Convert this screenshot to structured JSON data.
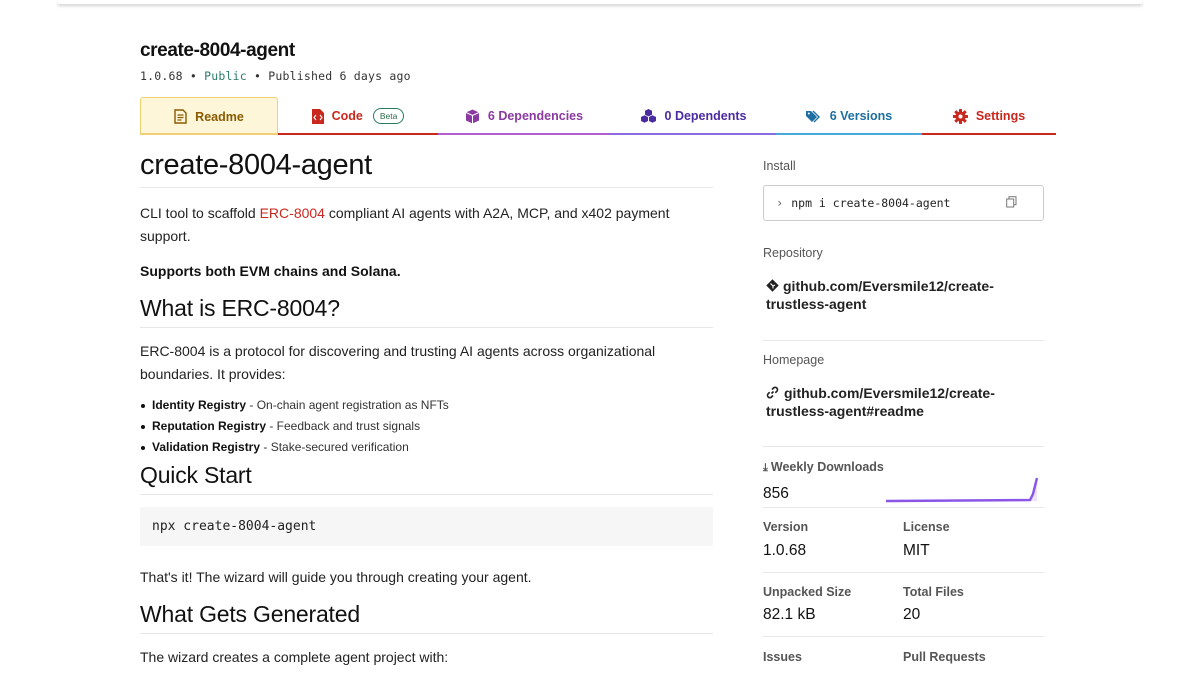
{
  "package": {
    "name": "create-8004-agent",
    "version": "1.0.68",
    "visibility": "Public",
    "published": "Published 6 days ago",
    "sep": "•"
  },
  "tabs": {
    "readme": "Readme",
    "code": "Code",
    "code_badge": "Beta",
    "dependencies": "6 Dependencies",
    "dependents": "0 Dependents",
    "versions": "6 Versions",
    "settings": "Settings"
  },
  "readme": {
    "title": "create-8004-agent",
    "intro_pre": "CLI tool to scaffold ",
    "intro_link": "ERC-8004",
    "intro_post": " compliant AI agents with A2A, MCP, and x402 payment support.",
    "supports": "Supports both EVM chains and Solana.",
    "h_what": "What is ERC-8004?",
    "what_para": "ERC-8004 is a protocol for discovering and trusting AI agents across organizational boundaries. It provides:",
    "bullets": [
      {
        "bold": "Identity Registry",
        "text": " - On-chain agent registration as NFTs"
      },
      {
        "bold": "Reputation Registry",
        "text": " - Feedback and trust signals"
      },
      {
        "bold": "Validation Registry",
        "text": " - Stake-secured verification"
      }
    ],
    "h_quick": "Quick Start",
    "quick_cmd": "npx create-8004-agent",
    "quick_para": "That's it! The wizard will guide you through creating your agent.",
    "h_generated": "What Gets Generated",
    "generated_para": "The wizard creates a complete agent project with:"
  },
  "sidebar": {
    "install_label": "Install",
    "install_cmd": "npm i create-8004-agent",
    "repository_label": "Repository",
    "repository_line1": "github.com/Eversmile12/create-",
    "repository_line2": "trustless-agent",
    "homepage_label": "Homepage",
    "homepage_line1": "github.com/Eversmile12/create-",
    "homepage_line2": "trustless-agent#readme",
    "downloads_label": "Weekly Downloads",
    "downloads_value": "856",
    "version_label": "Version",
    "version_value": "1.0.68",
    "license_label": "License",
    "license_value": "MIT",
    "unpacked_label": "Unpacked Size",
    "unpacked_value": "82.1 kB",
    "files_label": "Total Files",
    "files_value": "20",
    "issues_label": "Issues",
    "pulls_label": "Pull Requests"
  },
  "colors": {
    "npm_red": "#c8281e",
    "public_green": "#2a7a6a",
    "sparkline": "#8956e8"
  }
}
